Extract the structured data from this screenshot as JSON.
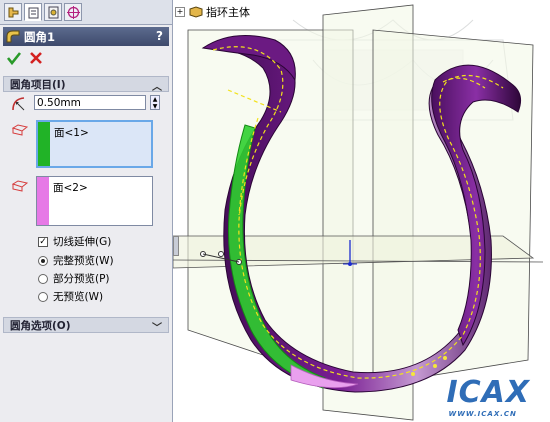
{
  "tabs": [
    {
      "name": "featuremanager-tab",
      "icon": "tree-icon"
    },
    {
      "name": "propertymanager-tab",
      "icon": "property-icon",
      "active": true
    },
    {
      "name": "configuration-tab",
      "icon": "config-icon"
    },
    {
      "name": "dimxpert-tab",
      "icon": "target-icon"
    }
  ],
  "feature": {
    "title": "圆角1",
    "help": "?"
  },
  "groups": {
    "items": "圆角项目(I)",
    "options": "圆角选项(O)"
  },
  "radius": {
    "value": "0.50mm"
  },
  "faces": {
    "list1": [
      "面<1>"
    ],
    "list2": [
      "面<2>"
    ],
    "color1": "#21b327",
    "color2": "#e679e6"
  },
  "options": {
    "tangent": "切线延伸(G)",
    "preview_full": "完整预览(W)",
    "preview_partial": "部分预览(P)",
    "preview_none": "无预览(W)"
  },
  "tree": {
    "label": "指环主体"
  },
  "watermark": {
    "main": "ICAX",
    "sub": "WWW.ICAX.CN"
  }
}
